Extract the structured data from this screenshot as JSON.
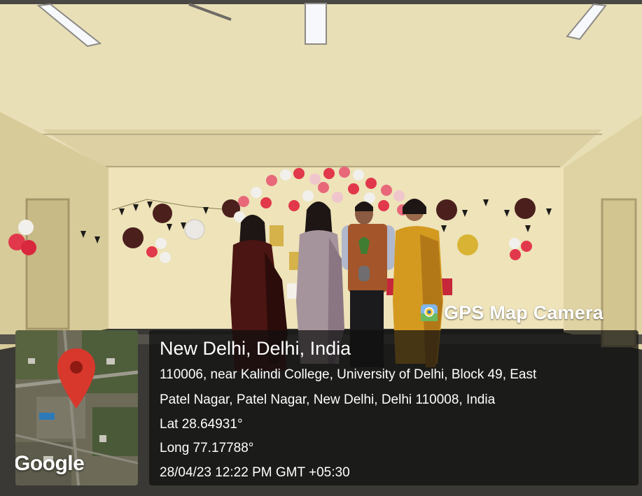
{
  "badge": {
    "icon": "gps-map-camera-icon",
    "text": "GPS Map Camera"
  },
  "location": {
    "title": "New Delhi, Delhi, India",
    "address_line1": "110006, near Kalindi College, University of Delhi, Block 49, East",
    "address_line2": "Patel Nagar, Patel Nagar, New Delhi, Delhi 110008, India",
    "lat": "Lat 28.64931°",
    "long": "Long 77.17788°",
    "datetime": "28/04/23 12:22 PM GMT +05:30"
  },
  "map": {
    "logo": "Google",
    "pin_icon": "map-pin-icon",
    "pin_color": "#d8382c"
  },
  "colors": {
    "wall": "#e7dcae",
    "panel": "#0f0f0f",
    "balloon_red": "#e2384b"
  }
}
